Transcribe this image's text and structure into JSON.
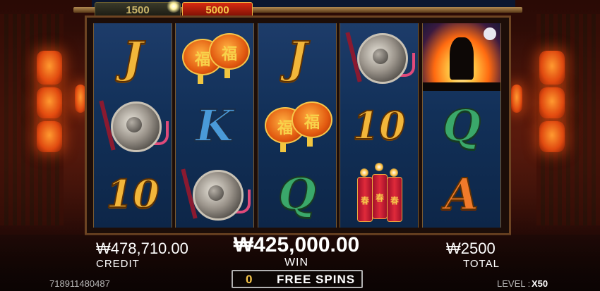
{
  "meter": {
    "left_value": "1500",
    "right_value": "5000"
  },
  "reels": [
    [
      {
        "type": "letter",
        "text": "J",
        "tone": "gold"
      },
      {
        "type": "gong"
      },
      {
        "type": "number",
        "text": "10",
        "tone": "gold"
      }
    ],
    [
      {
        "type": "lanterns",
        "glyph": "福"
      },
      {
        "type": "letter",
        "text": "K",
        "tone": "blue"
      },
      {
        "type": "gong"
      }
    ],
    [
      {
        "type": "letter",
        "text": "J",
        "tone": "gold"
      },
      {
        "type": "lanterns",
        "glyph": "福"
      },
      {
        "type": "letter",
        "text": "Q",
        "tone": "green"
      }
    ],
    [
      {
        "type": "gong"
      },
      {
        "type": "number",
        "text": "10",
        "tone": "gold"
      },
      {
        "type": "firecrackers",
        "glyph": "春"
      }
    ],
    [
      {
        "type": "fire"
      },
      {
        "type": "letter",
        "text": "Q",
        "tone": "green"
      },
      {
        "type": "letter",
        "text": "A",
        "tone": "orange"
      }
    ]
  ],
  "credit": {
    "value": "₩478,710.00",
    "label": "CREDIT"
  },
  "win": {
    "value": "₩425,000.00",
    "label": "WIN"
  },
  "total": {
    "value": "₩2500",
    "label": "TOTAL"
  },
  "free_spins": {
    "count": "0",
    "label": "FREE SPINS"
  },
  "session_id": "718911480487",
  "level": {
    "label": "LEVEL :",
    "value": "X50"
  },
  "colors": {
    "gold": "#f2b63a",
    "accent_red": "#d82a10",
    "reel_blue": "#123058"
  }
}
